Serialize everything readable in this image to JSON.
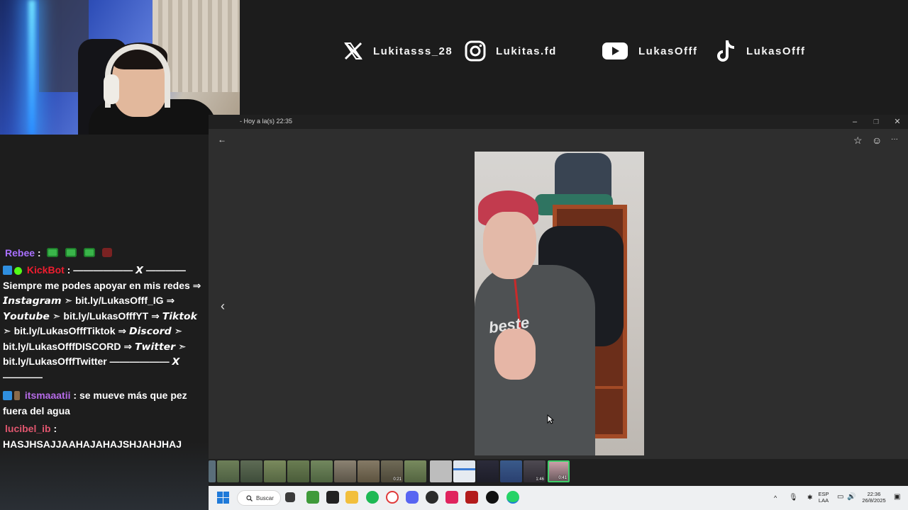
{
  "socials": [
    {
      "icon": "x-logo-icon",
      "handle": "Lukitasss_28"
    },
    {
      "icon": "instagram-icon",
      "handle": "Lukitas.fd"
    },
    {
      "icon": "youtube-icon",
      "handle": "LukasOfff"
    },
    {
      "icon": "tiktok-icon",
      "handle": "LukasOfff"
    }
  ],
  "chat": {
    "messages": [
      {
        "user": "Rebee",
        "color": "#a970ff",
        "text": ""
      },
      {
        "user": "KickBot",
        "color": "#ef1d2f",
        "text": "—————— 𝙓 ———— Siempre me podes apoyar en mis redes ⇒ 𝙄𝙣𝙨𝙩𝙖𝙜𝙧𝙖𝙢 ➣ bit.ly/LukasOfff_IG ⇒ 𝙔𝙤𝙪𝙩𝙪𝙗𝙚 ➣ bit.ly/LukasOfffYT ⇒ 𝙏𝙞𝙠𝙩𝙤𝙠 ➣ bit.ly/LukasOfffTiktok ⇒ 𝘿𝙞𝙨𝙘𝙤𝙧𝙙 ➣ bit.ly/LukasOfffDISCORD ⇒ 𝙏𝙬𝙞𝙩𝙩𝙚𝙧 ➣ bit.ly/LukasOfffTwitter —————— 𝙓 ————"
      },
      {
        "user": "itsmaaatii",
        "color": "#b66be8",
        "text": "se mueve más que pez fuera del agua"
      },
      {
        "user": "lucibel_ib",
        "color": "#e0566e",
        "text": "HASJHSAJJAAHAJAHAJSHJAHJHAJ"
      }
    ]
  },
  "window": {
    "title": "- Hoy a la(s) 22:35",
    "minimize": "–",
    "restore": "❐",
    "close": "✕",
    "back": "←",
    "prev": "‹",
    "star": "☆",
    "emoji": "☺",
    "more": "···"
  },
  "filmstrip": {
    "badges": [
      "0:21",
      "1:46",
      "0:41"
    ]
  },
  "taskbar": {
    "search_label": "Buscar",
    "lang_top": "ESP",
    "lang_bottom": "LAA",
    "time": "22:36",
    "date": "26/8/2025"
  },
  "colors": {
    "accent": "#1f7ad9",
    "chat_bg": "#1d1d1d"
  }
}
